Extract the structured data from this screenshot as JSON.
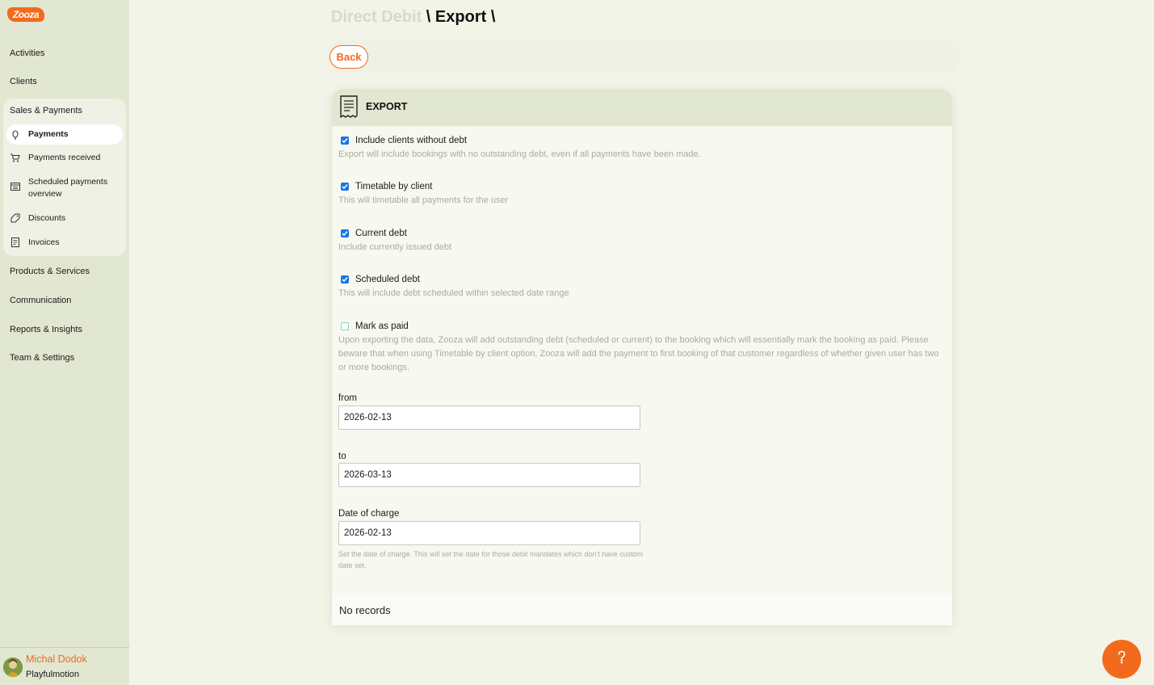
{
  "sidebar": {
    "logo_text": "Zooza",
    "items": [
      {
        "label": "Activities"
      },
      {
        "label": "Clients"
      }
    ],
    "group": {
      "title": "Sales & Payments",
      "items": [
        {
          "label": "Payments",
          "icon": "piggy-bank-icon",
          "active": true
        },
        {
          "label": "Payments received",
          "icon": "cart-icon"
        },
        {
          "label": "Scheduled payments overview",
          "icon": "calendar-icon"
        },
        {
          "label": "Discounts",
          "icon": "tag-icon"
        },
        {
          "label": "Invoices",
          "icon": "receipt-icon"
        }
      ]
    },
    "bottom_items": [
      {
        "label": "Products & Services"
      },
      {
        "label": "Communication"
      },
      {
        "label": "Reports & Insights"
      },
      {
        "label": "Team & Settings"
      }
    ],
    "user": {
      "name": "Michal Dodok",
      "org": "Playfulmotion"
    }
  },
  "breadcrumb": {
    "parent": "Direct Debit",
    "sep1": " \\ ",
    "current": "Export",
    "sep2": " \\"
  },
  "toolbar": {
    "back_label": "Back"
  },
  "card": {
    "title": "EXPORT",
    "options": [
      {
        "label": "Include clients without debt",
        "checked": true,
        "desc": "Export will include bookings with no outstanding debt, even if all payments have been made."
      },
      {
        "label": "Timetable by client",
        "checked": true,
        "desc": "This will timetable all payments for the user"
      },
      {
        "label": "Current debt",
        "checked": true,
        "desc": "Include currently issued debt"
      },
      {
        "label": "Scheduled debt",
        "checked": true,
        "desc": "This will include debt scheduled within selected date range"
      },
      {
        "label": "Mark as paid",
        "checked": false,
        "desc": "Upon exporting the data, Zooza will add outstanding debt (scheduled or current) to the booking which will essentially mark the booking as paid. Please beware that when using Timetable by client option, Zooza will add the payment to first booking of that customer regardless of whether given user has two or more bookings."
      }
    ],
    "fields": {
      "from": {
        "label": "from",
        "value": "2026-02-13"
      },
      "to": {
        "label": "to",
        "value": "2026-03-13"
      },
      "charge": {
        "label": "Date of charge",
        "value": "2026-02-13"
      }
    },
    "hint": "Set the date of charge. This will set the date for those debit mandates which don't have custom date set.",
    "records": "No records"
  },
  "colors": {
    "accent": "#f26b1d",
    "checkbox": "#1a73e8",
    "sidebar": "#e2e7d2"
  }
}
